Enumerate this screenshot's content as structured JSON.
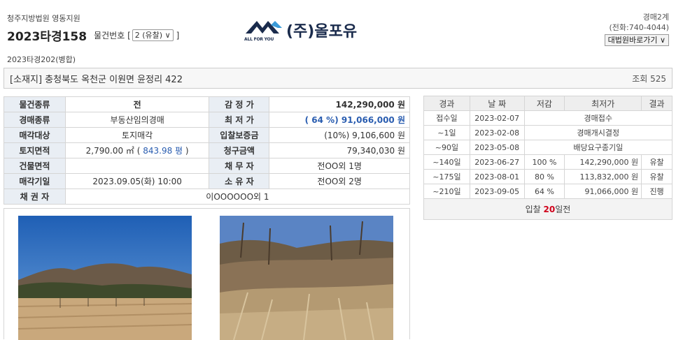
{
  "header": {
    "court": "청주지방법원 영동지원",
    "case_no": "2023타경158",
    "item_label": "물건번호 [",
    "item_select": "2 (유찰) ∨",
    "item_close": "]",
    "merged": "2023타경202(병합)",
    "dept": "경매2계",
    "phone": "(전화:740-4044)",
    "court_button": "대법원바로가기 ∨"
  },
  "logo": {
    "text": "(주)올포유",
    "sub": "ALL FOR YOU",
    "color": "#1a2b4c"
  },
  "address": {
    "label": "[소재지] 충청북도 옥천군 이원면 윤정리 422",
    "views": "조회 525"
  },
  "info": {
    "labels": {
      "type": "물건종류",
      "appraisal": "감 정 가",
      "auction_type": "경매종류",
      "min_price": "최 저 가",
      "target": "매각대상",
      "deposit": "입찰보증금",
      "land_area": "토지면적",
      "claim": "청구금액",
      "building_area": "건물면적",
      "debtor": "채 무 자",
      "sale_date": "매각기일",
      "owner": "소 유 자",
      "creditor": "채 권 자"
    },
    "values": {
      "type": "전",
      "appraisal": "142,290,000 원",
      "auction_type": "부동산임의경매",
      "min_price": "( 64 %) 91,066,000 원",
      "target": "토지매각",
      "deposit": "(10%) 9,106,600 원",
      "land_area_m2": "2,790.00 ㎡ (",
      "land_area_py": "843.98 평",
      "land_area_close": ")",
      "claim": "79,340,030 원",
      "building_area": "",
      "debtor": "전OO외 1명",
      "sale_date": "2023.09.05(화) 10:00",
      "owner": "전OO외 2명",
      "creditor": "이OOOOOO외 1"
    }
  },
  "history": {
    "headers": [
      "경과",
      "날 짜",
      "저감",
      "최저가",
      "결과"
    ],
    "rows": [
      {
        "elapsed": "접수일",
        "date": "2023-02-07",
        "note": "경매접수"
      },
      {
        "elapsed": "~1일",
        "date": "2023-02-08",
        "note": "경매개시결정"
      },
      {
        "elapsed": "~90일",
        "date": "2023-05-08",
        "note": "배당요구종기일"
      },
      {
        "elapsed": "~140일",
        "date": "2023-06-27",
        "rate": "100 %",
        "price": "142,290,000 원",
        "result": "유찰"
      },
      {
        "elapsed": "~175일",
        "date": "2023-08-01",
        "rate": "80 %",
        "price": "113,832,000 원",
        "result": "유찰"
      },
      {
        "elapsed": "~210일",
        "date": "2023-09-05",
        "rate": "64 %",
        "price": "91,066,000 원",
        "result": "진행"
      }
    ],
    "footer_pre": "입찰 ",
    "footer_days": "20",
    "footer_post": "일전"
  }
}
